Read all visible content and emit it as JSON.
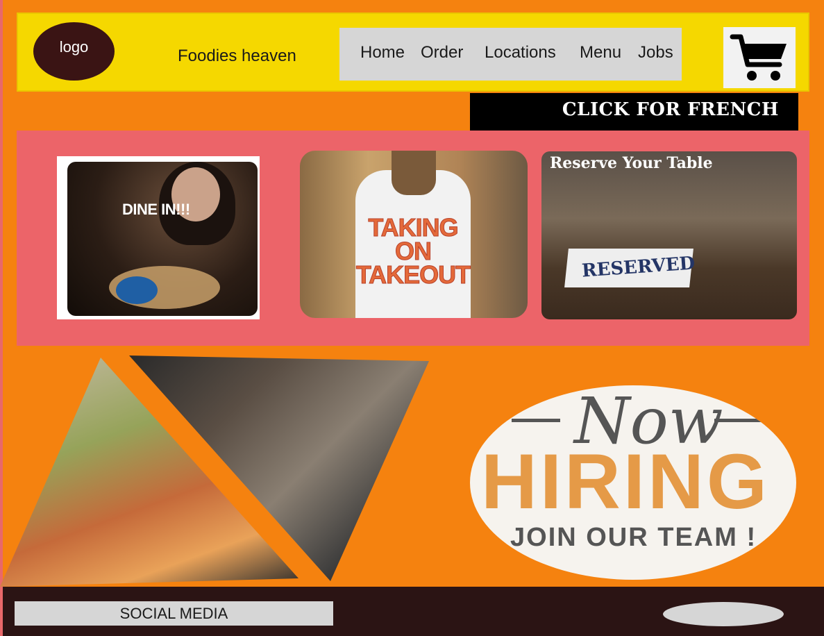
{
  "header": {
    "logo_text": "logo",
    "site_name": "Foodies heaven",
    "nav": [
      {
        "label": "Home"
      },
      {
        "label": "Order"
      },
      {
        "label": "Locations"
      },
      {
        "label": "Menu"
      },
      {
        "label": "Jobs"
      }
    ],
    "cart_icon": "shopping-cart-icon"
  },
  "language_button": "CLICK FOR FRENCH",
  "cards": {
    "dine_in": {
      "text": "DINE IN!!!"
    },
    "takeout": {
      "text": "TAKING ON TAKEOUT"
    },
    "reserve": {
      "title": "Reserve Your Table",
      "sign": "RESERVED"
    }
  },
  "hiring": {
    "now": "Now",
    "word": "HIRING",
    "join": "JOIN OUR TEAM !"
  },
  "footer": {
    "social_label": "SOCIAL MEDIA"
  },
  "colors": {
    "background": "#f5820f",
    "header": "#f5d800",
    "band": "#ec6469",
    "footer": "#2b1414",
    "logo": "#3a1414"
  }
}
